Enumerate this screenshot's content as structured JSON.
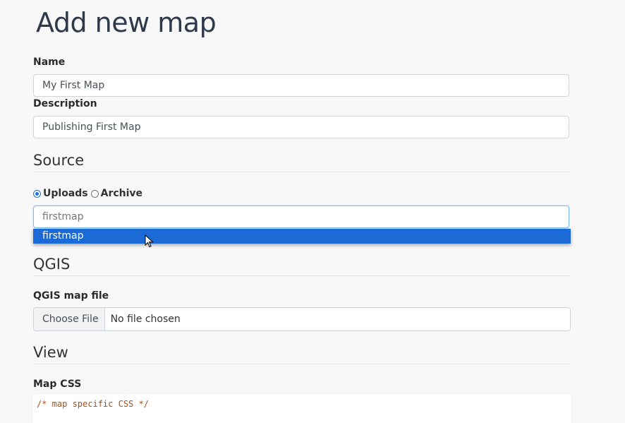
{
  "page": {
    "title": "Add new map"
  },
  "form": {
    "name": {
      "label": "Name",
      "value": "My First Map"
    },
    "description": {
      "label": "Description",
      "value": "Publishing First Map"
    },
    "source": {
      "heading": "Source",
      "options": [
        {
          "label": "Uploads",
          "checked": true
        },
        {
          "label": "Archive",
          "checked": false
        }
      ],
      "input_value": "firstmap",
      "suggestions": [
        "firstmap"
      ]
    },
    "qgis": {
      "heading": "QGIS",
      "file_label": "QGIS map file",
      "choose_button": "Choose File",
      "file_status": "No file chosen"
    },
    "view": {
      "heading": "View",
      "css_label": "Map CSS",
      "css_value": "/* map specific CSS */"
    }
  },
  "colors": {
    "accent": "#1c6ad6",
    "heading": "#2e3a4b"
  },
  "icons": {
    "pointer": "mouse-pointer-icon"
  }
}
